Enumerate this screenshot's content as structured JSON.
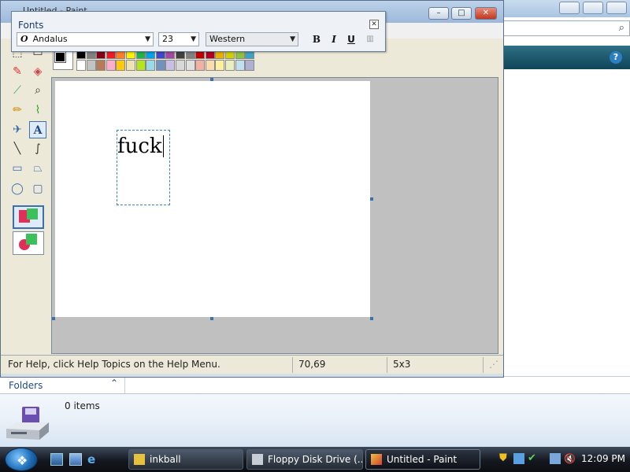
{
  "paint": {
    "title": "Untitled - Paint",
    "status": {
      "help": "For Help, click Help Topics on the Help Menu.",
      "coords": "70,69",
      "size": "5x3"
    },
    "text_content": "fuck"
  },
  "fonts_toolbar": {
    "title": "Fonts",
    "font_name": "Andalus",
    "font_size": "23",
    "script": "Western",
    "bold_label": "B",
    "italic_label": "I",
    "underline_label": "U"
  },
  "palette": {
    "foreground": "#000000",
    "background": "#ffffff",
    "row1": [
      "#000000",
      "#7f7f7f",
      "#880015",
      "#ed1c24",
      "#ff7f27",
      "#fff200",
      "#22b14c",
      "#00a2e8",
      "#3f48cc",
      "#a349a4",
      "#404040",
      "#808080",
      "#c00000",
      "#b00020",
      "#e6b000",
      "#d0d000",
      "#90c040",
      "#40a0c0"
    ],
    "row2": [
      "#ffffff",
      "#c3c3c3",
      "#b97a57",
      "#ffaec9",
      "#ffc90e",
      "#efe4b0",
      "#b5e61d",
      "#99d9ea",
      "#7092be",
      "#c8bfe7",
      "#d8d8d8",
      "#e0e0e0",
      "#f4b0a0",
      "#fadcb0",
      "#fff0a0",
      "#e8f0c0",
      "#c0e0f0",
      "#b0b0d0"
    ]
  },
  "explorer": {
    "folders_label": "Folders",
    "item_count": "0 items"
  },
  "taskbar": {
    "buttons": [
      {
        "label": "inkball"
      },
      {
        "label": "Floppy Disk Drive (..."
      },
      {
        "label": "Untitled - Paint"
      }
    ],
    "clock": "12:09 PM"
  }
}
